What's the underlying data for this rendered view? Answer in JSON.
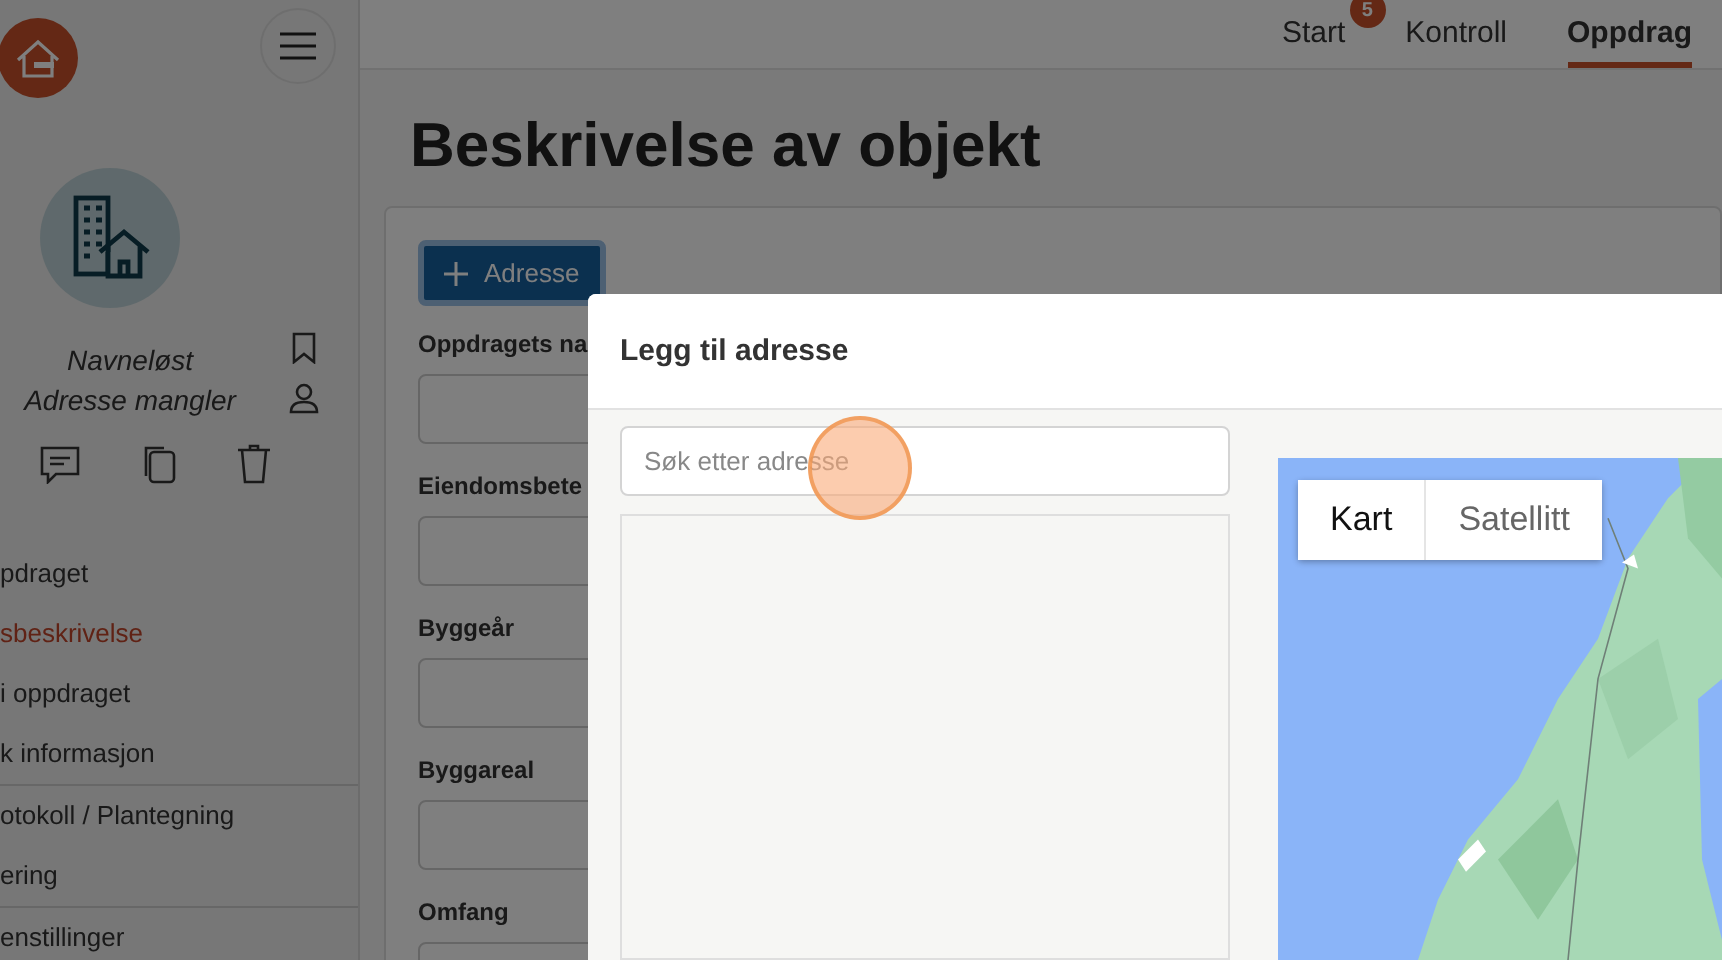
{
  "header": {
    "nav": [
      {
        "label": "Start",
        "badge": "5",
        "selected": false
      },
      {
        "label": "Kontroll",
        "selected": false
      },
      {
        "label": "Oppdrag",
        "selected": true
      }
    ]
  },
  "sidebar": {
    "title": "Navneløst",
    "subtitle": "Adresse mangler",
    "menu_groups": [
      {
        "items": [
          {
            "label": "pdraget",
            "selected": false
          },
          {
            "label": "sbeskrivelse",
            "selected": true
          },
          {
            "label": "i oppdraget",
            "selected": false
          },
          {
            "label": "k informasjon",
            "selected": false
          }
        ]
      },
      {
        "items": [
          {
            "label": "otokoll / Plantegning",
            "selected": false
          },
          {
            "label": "ering",
            "selected": false
          }
        ]
      },
      {
        "items": [
          {
            "label": "enstillinger",
            "selected": false
          }
        ]
      }
    ]
  },
  "page": {
    "title": "Beskrivelse av objekt",
    "add_button": "Adresse",
    "fields": [
      {
        "label": "Oppdragets na"
      },
      {
        "label": "Eiendomsbete"
      },
      {
        "label": "Byggeår"
      },
      {
        "label": "Byggareal"
      },
      {
        "label": "Omfang"
      }
    ]
  },
  "modal": {
    "title": "Legg til adresse",
    "search": {
      "placeholder": "Søk etter adresse"
    },
    "map_types": [
      {
        "label": "Kart",
        "selected": true
      },
      {
        "label": "Satellitt",
        "selected": false
      }
    ]
  }
}
